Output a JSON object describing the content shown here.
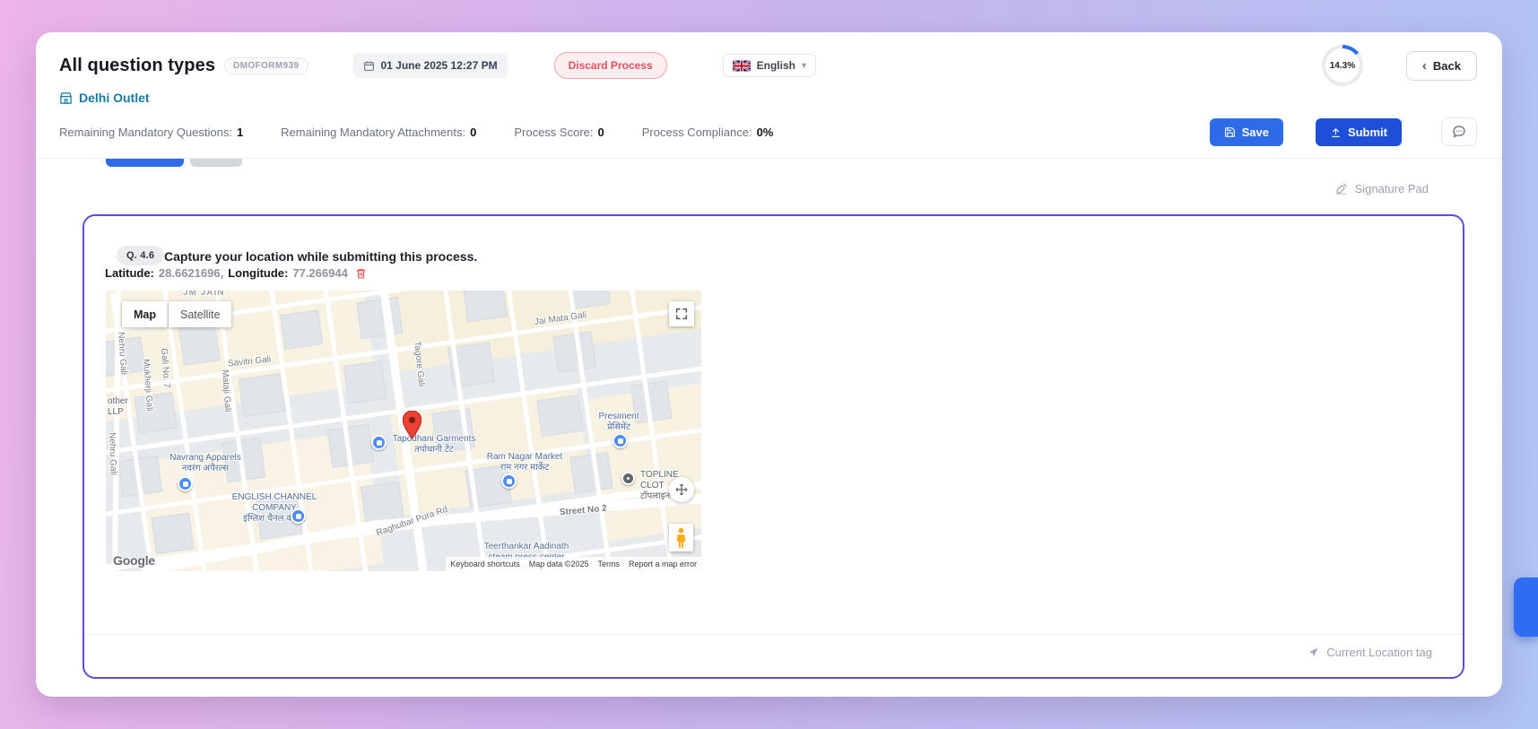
{
  "header": {
    "title": "All question types",
    "form_code": "DMOFORM939",
    "datetime": "01 June 2025 12:27 PM",
    "discard_label": "Discard Process",
    "language_label": "English",
    "progress_percent": "14.3%",
    "back_label": "Back",
    "outlet_name": "Delhi Outlet"
  },
  "stats": {
    "items": [
      {
        "label": "Remaining Mandatory Questions:",
        "value": "1"
      },
      {
        "label": "Remaining Mandatory Attachments:",
        "value": "0"
      },
      {
        "label": "Process Score:",
        "value": "0"
      },
      {
        "label": "Process Compliance:",
        "value": "0%"
      }
    ],
    "save_label": "Save",
    "submit_label": "Submit"
  },
  "content": {
    "signature_pad_label": "Signature Pad",
    "current_location_label": "Current Location tag"
  },
  "question": {
    "number": "Q. 4.6",
    "text": "Capture your location while submitting this process.",
    "latitude_label": "Latitude:",
    "latitude_value": "28.6621696,",
    "longitude_label": "Longitude:",
    "longitude_value": "77.266944"
  },
  "map": {
    "mode_map": "Map",
    "mode_satellite": "Satellite",
    "google_logo": "Google",
    "labels": [
      "JM JAIN",
      "Jai Mata Gali",
      "Savitri Gali",
      "Tagore Gali",
      "Nehru Gali",
      "Mukherji Gali",
      "Gali No. 7",
      "Mataji Gali",
      "other\nLLP",
      "Navrang Apparels\nनवरंग अपैरल्स",
      "ENGLISH CHANNEL\nCOMPANY\nइंग्लिश चैनल कंपनी",
      "Tapodhani Garments\nतपोधानी टेंट",
      "Ram Nagar Market\nराम नगर मार्केट",
      "Presiment\nप्रेसिमेंट",
      "TOPLINE CLOT\nटॉपलाइन क",
      "Street No 2",
      "Teerthankar Aadinath\nsteam press center",
      "Raghubar Pura Rd",
      "Nehru Gali"
    ],
    "footer": [
      "Keyboard shortcuts",
      "Map data ©2025",
      "Terms",
      "Report a map error"
    ]
  },
  "colors": {
    "accent_blue": "#2e6be6",
    "submit_blue": "#1d4fd7",
    "question_border": "#5b4ed1",
    "discard_red": "#e84f5e",
    "outlet_blue": "#177ba6",
    "pin_red": "#ea4335"
  }
}
